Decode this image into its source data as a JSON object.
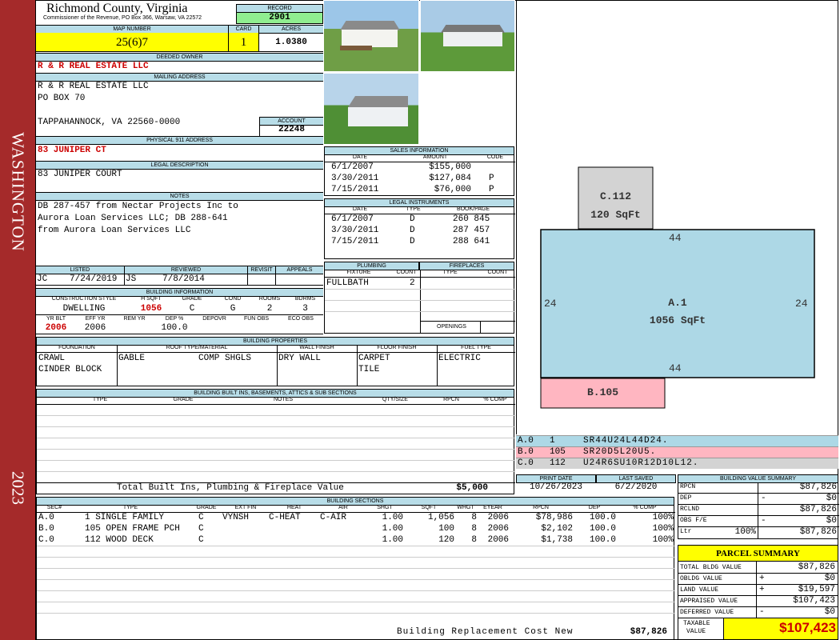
{
  "side_banner": {
    "city": "WASHINGTON",
    "year": "2023"
  },
  "header": {
    "county": "Richmond County, Virginia",
    "commissioner": "Commissioner of the Revenue, PO Box 366, Warsaw, VA 22572",
    "record_label": "RECORD",
    "record": "2901",
    "map_number_label": "MAP NUMBER",
    "map_number": "25(6)7",
    "card_label": "CARD",
    "card": "1",
    "acres_label": "ACRES",
    "acres": "1.0380"
  },
  "owner": {
    "deeded_owner_label": "DEEDED OWNER",
    "deeded_owner": "R & R REAL ESTATE LLC",
    "mailing_label": "MAILING ADDRESS",
    "mailing_line1": "R & R REAL ESTATE LLC",
    "mailing_line2": "PO BOX 70",
    "mailing_line3": "TAPPAHANNOCK, VA 22560-0000",
    "account_label": "ACCOUNT",
    "account": "22248",
    "physical_label": "PHYSICAL 911 ADDRESS",
    "physical": "83 JUNIPER CT",
    "legal_label": "LEGAL DESCRIPTION",
    "legal": "83 JUNIPER COURT",
    "notes_label": "NOTES",
    "notes_line1": "DB 287-457 from Nectar Projects Inc to",
    "notes_line2": "Aurora Loan Services LLC; DB 288-641",
    "notes_line3": "from Aurora Loan Services LLC"
  },
  "sales": {
    "title": "SALES INFORMATION",
    "headers": [
      "DATE",
      "AMOUNT",
      "CODE"
    ],
    "rows": [
      {
        "date": "6/1/2007",
        "amount": "$155,000",
        "code": ""
      },
      {
        "date": "3/30/2011",
        "amount": "$127,084",
        "code": "P"
      },
      {
        "date": "7/15/2011",
        "amount": "$76,000",
        "code": "P"
      }
    ]
  },
  "legal_instruments": {
    "title": "LEGAL INSTRUMENTS",
    "headers": [
      "DATE",
      "TYPE",
      "BOOK/PAGE"
    ],
    "rows": [
      {
        "date": "6/1/2007",
        "type": "D",
        "book": "260 845"
      },
      {
        "date": "3/30/2011",
        "type": "D",
        "book": "287 457"
      },
      {
        "date": "7/15/2011",
        "type": "D",
        "book": "288 641"
      }
    ]
  },
  "review": {
    "listed_label": "LISTED",
    "reviewed_label": "REVIEWED",
    "revisit_label": "REVISIT",
    "appeals_label": "APPEALS",
    "listed_by": "JC",
    "listed_date": "7/24/2019",
    "reviewed_by": "JS",
    "reviewed_date": "7/8/2014"
  },
  "building_info": {
    "title": "BUILDING INFORMATION",
    "headers1": [
      "CONSTRUCTION STYLE",
      "H SQFT",
      "GRADE",
      "COND",
      "ROOMS",
      "BDRMS"
    ],
    "style": "DWELLING",
    "hsqft": "1056",
    "grade": "C",
    "cond": "G",
    "rooms": "2",
    "bdrms": "3",
    "headers2": [
      "YR BLT",
      "EFF YR",
      "REM YR",
      "DEP %",
      "DEPOVR",
      "FUN OBS",
      "ECO OBS"
    ],
    "yr_blt": "2006",
    "eff_yr": "2006",
    "dep": "100.0"
  },
  "plumbing": {
    "title": "PLUMBING",
    "headers": [
      "FIXTURE",
      "COUNT"
    ],
    "fixture": "FULLBATH",
    "count": "2"
  },
  "fireplaces": {
    "title": "FIREPLACES",
    "headers": [
      "TYPE",
      "COUNT"
    ],
    "openings_label": "OPENINGS"
  },
  "properties": {
    "title": "BUILDING PROPERTIES",
    "headers": [
      "FOUNDATION",
      "ROOF TYPE/MATERIAL",
      "WALL FINISH",
      "FLOOR FINISH",
      "FUEL TYPE"
    ],
    "foundation1": "CRAWL",
    "foundation2": "CINDER BLOCK",
    "roof_type": "GABLE",
    "roof_material": "COMP SHGLS",
    "wall": "DRY WALL",
    "floor1": "CARPET",
    "floor2": "TILE",
    "fuel": "ELECTRIC"
  },
  "builtins": {
    "title": "BUILDING BUILT INS, BASEMENTS, ATTICS & SUB SECTIONS",
    "headers": [
      "TYPE",
      "GRADE",
      "NOTES",
      "QTY/SIZE",
      "RPCN",
      "% COMP"
    ],
    "total_label": "Total Built Ins, Plumbing & Fireplace Value",
    "total": "$5,000"
  },
  "dates": {
    "print_label": "PRINT DATE",
    "print": "10/26/2023",
    "saved_label": "LAST SAVED",
    "saved": "6/2/2020"
  },
  "sections": {
    "title": "BUILDING SECTIONS",
    "headers": [
      "SEC#",
      "TYPE",
      "GRADE",
      "EXT FIN",
      "HEAT",
      "AIR",
      "SHGT",
      "SQFT",
      "WHGT",
      "EYEAR",
      "RPCN",
      "DEP",
      "% COMP"
    ],
    "rows": [
      {
        "sec": "A.0",
        "type": "1 SINGLE FAMILY",
        "grade": "C",
        "ext": "VYNSH",
        "heat": "C-HEAT",
        "air": "C-AIR",
        "shgt": "1.00",
        "sqft": "1,056",
        "whgt": "8",
        "eyear": "2006",
        "rpcn": "$78,986",
        "dep": "100.0",
        "comp": "100%"
      },
      {
        "sec": "B.0",
        "type": "105 OPEN FRAME PCH",
        "grade": "C",
        "ext": "",
        "heat": "",
        "air": "",
        "shgt": "1.00",
        "sqft": "100",
        "whgt": "8",
        "eyear": "2006",
        "rpcn": "$2,102",
        "dep": "100.0",
        "comp": "100%"
      },
      {
        "sec": "C.0",
        "type": "112 WOOD DECK",
        "grade": "C",
        "ext": "",
        "heat": "",
        "air": "",
        "shgt": "1.00",
        "sqft": "120",
        "whgt": "8",
        "eyear": "2006",
        "rpcn": "$1,738",
        "dep": "100.0",
        "comp": "100%"
      }
    ],
    "brcn_label": "Building Replacement Cost New",
    "brcn": "$87,826"
  },
  "sketch": {
    "c_label": "C.112",
    "c_area": "120 SqFt",
    "a_label": "A.1",
    "a_area": "1056 SqFt",
    "b_label": "B.105",
    "dim_top": "44",
    "dim_bottom": "44",
    "dim_left": "24",
    "dim_right": "24",
    "colors": {
      "a": "#add8e6",
      "b": "#ffb6c1",
      "c": "#d3d3d3"
    },
    "legend": [
      {
        "sec": "A.0",
        "code": "1",
        "path": "SR44U24L44D24."
      },
      {
        "sec": "B.0",
        "code": "105",
        "path": "SR20D5L20U5."
      },
      {
        "sec": "C.0",
        "code": "112",
        "path": "U24R6SU10R12D10L12."
      }
    ]
  },
  "value_summary": {
    "title": "BUILDING VALUE SUMMARY",
    "rpcn_label": "RPCN",
    "rpcn": "$87,826",
    "dep_label": "DEP",
    "dep_sign": "-",
    "dep": "$0",
    "rcnld_label": "RCLND",
    "rcnld": "$87,826",
    "obs_label": "OBS F/E",
    "obs_sign": "-",
    "obs": "$0",
    "ltr_label": "Ltr",
    "ltr_pct": "100%",
    "ltr": "$87,826"
  },
  "parcel": {
    "title": "PARCEL SUMMARY",
    "total_bldg_label": "TOTAL BLDG VALUE",
    "total_bldg": "$87,826",
    "obldg_label": "OBLDG VALUE",
    "obldg_sign": "+",
    "obldg": "$0",
    "land_label": "LAND VALUE",
    "land_sign": "+",
    "land": "$19,597",
    "appraised_label": "APPRAISED VALUE",
    "appraised": "$107,423",
    "deferred_label": "DEFERRED VALUE",
    "deferred_sign": "-",
    "deferred": "$0",
    "taxable_label1": "TAXABLE",
    "taxable_label2": "VALUE",
    "taxable": "$107,423"
  }
}
